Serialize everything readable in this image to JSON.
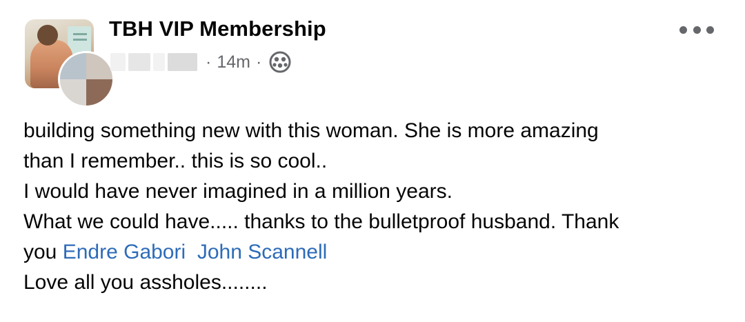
{
  "post": {
    "group_name": "TBH VIP Membership",
    "timestamp": "14m",
    "separator": "·",
    "privacy_icon": "friends-icon",
    "more_icon": "more-options-icon",
    "body": {
      "line1": "building something new with this woman. She is more amazing",
      "line2": "than I remember.. this is so cool..",
      "line3": "I would have never imagined in a million years.",
      "line4": "What we could have..... thanks to the bulletproof husband. Thank",
      "line5_prefix": "you",
      "mention_1": "Endre Gabori",
      "mention_2": "John Scannell",
      "line6": "Love all you assholes........"
    }
  },
  "colors": {
    "text": "#050505",
    "meta": "#65676b",
    "link": "#2d6bb8",
    "background": "#ffffff"
  }
}
